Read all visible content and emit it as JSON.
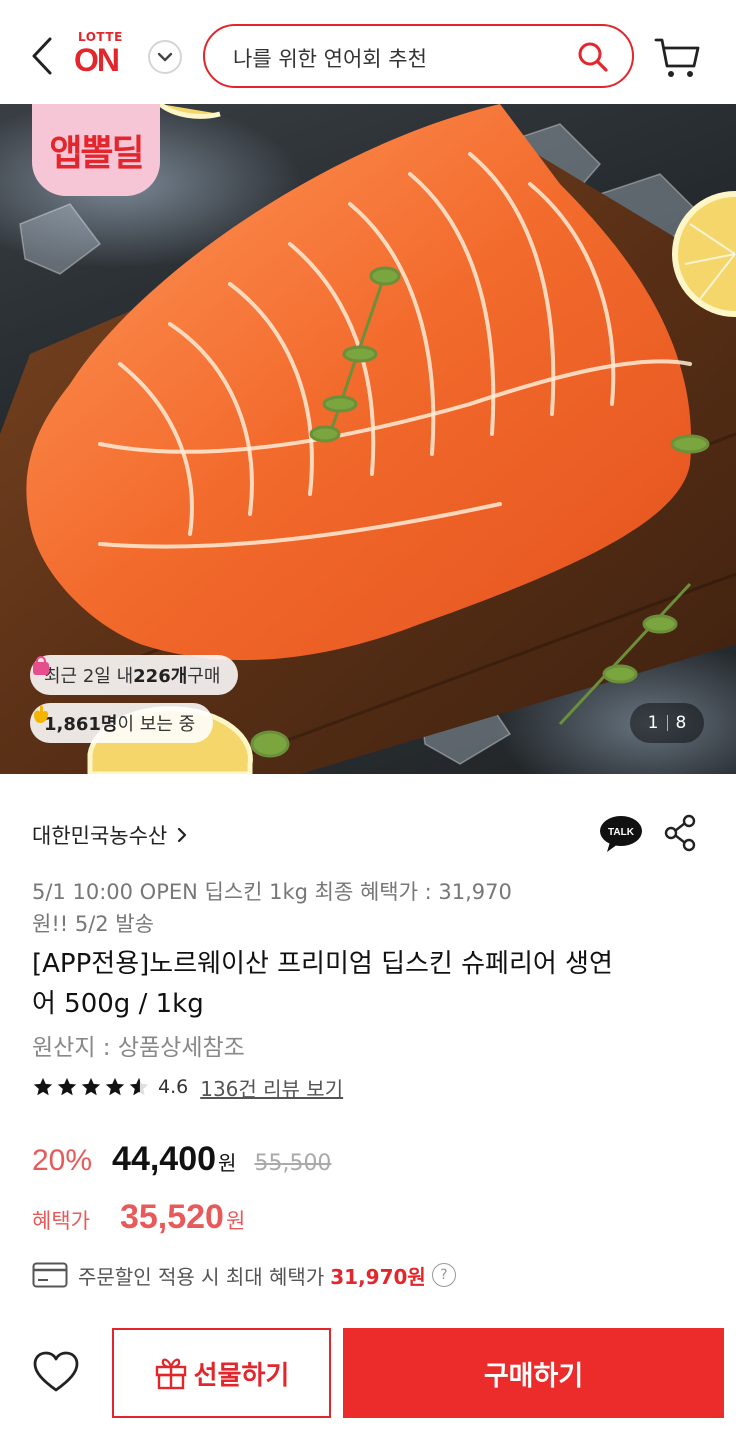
{
  "header": {
    "logo_top": "LOTTE",
    "logo_main": "ON",
    "search_query": "나를 위한 연어회 추천"
  },
  "hero": {
    "badge": "앱뽈딜",
    "recent_prefix": "최근 2일 내 ",
    "recent_count": "226개",
    "recent_suffix": " 구매",
    "viewers_count": "1,861명",
    "viewers_suffix": "이 보는 중",
    "image_index": "1",
    "image_total": "8"
  },
  "product": {
    "seller": "대한민국농수산",
    "promo_line1": "5/1 10:00 OPEN 딥스킨 1kg 최종 혜택가 : 31,970",
    "promo_line2": "원!! 5/2 발송",
    "title_line1": "[APP전용]노르웨이산 프리미엄 딥스킨 슈페리어 생연",
    "title_line2": "어 500g / 1kg",
    "origin": "원산지 : 상품상세참조",
    "rating": 4.6,
    "rating_text": "4.6",
    "review_link": "136건 리뷰 보기",
    "discount": "20%",
    "sale_price": "44,400",
    "won": "원",
    "original_price": "55,500",
    "benefit_label": "혜택가",
    "benefit_price": "35,520",
    "coupon_text": "주문할인 적용 시 최대 혜택가",
    "coupon_max": "31,970원",
    "help": "?"
  },
  "bottom_bar": {
    "gift_label": "선물하기",
    "buy_label": "구매하기"
  },
  "colors": {
    "brand_red": "#e3262c",
    "discount_red": "#e85a5a",
    "buy_button": "#ec2b2b"
  },
  "icons": [
    "back-icon",
    "chevron-down-icon",
    "search-icon",
    "cart-icon",
    "shopping-bag-icon",
    "hand-icon",
    "talk-icon",
    "share-icon",
    "star-icon",
    "card-icon",
    "help-icon",
    "heart-icon",
    "gift-icon"
  ]
}
